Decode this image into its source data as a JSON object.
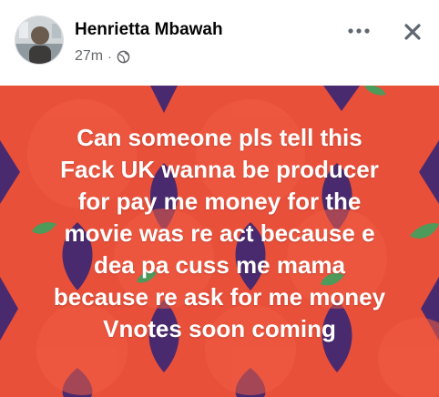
{
  "post": {
    "author_name": "Henrietta Mbawah",
    "timestamp": "27m",
    "separator": "·",
    "privacy_icon": "globe-icon",
    "lines": [
      "Can someone pls tell this",
      "Fack UK wanna be producer",
      "for pay me money for the",
      "movie was re act because e",
      "dea pa cuss me mama",
      "because re ask for me money",
      "Vnotes soon coming"
    ]
  },
  "header": {
    "more_icon": "more-options-icon",
    "close_icon": "close-icon"
  },
  "colors": {
    "background_red": "#e8503a",
    "background_purple": "#4a2a6e",
    "leaf_green": "#4d9a5a",
    "author_text": "#050505",
    "meta_text": "#65676b"
  }
}
